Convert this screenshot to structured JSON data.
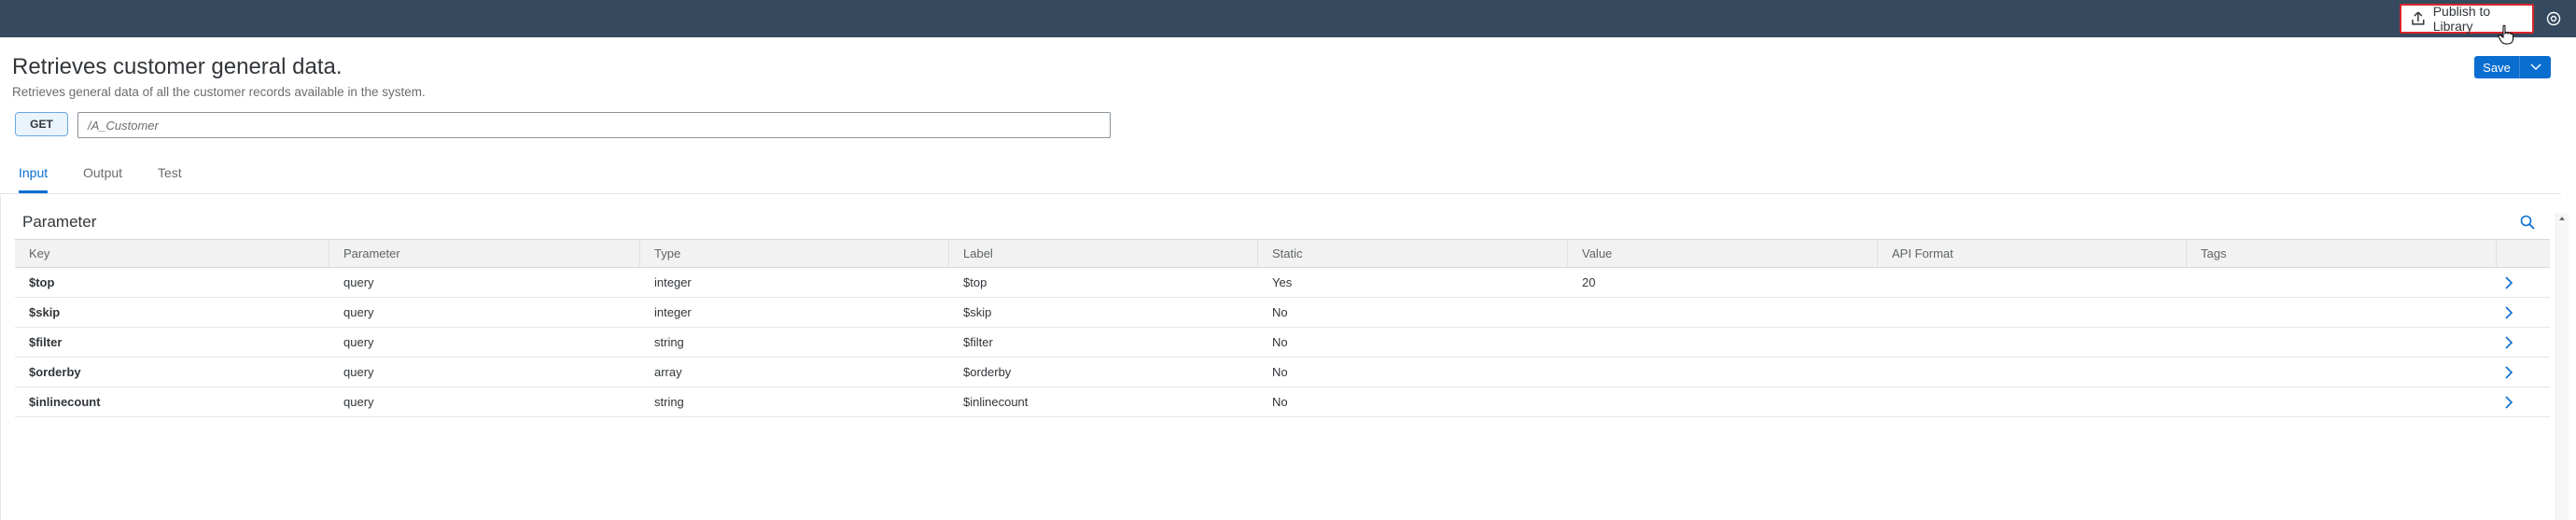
{
  "shell": {
    "publish_label": "Publish to Library",
    "icons": [
      "upload-icon",
      "settings-icon",
      "hand-cursor-icon"
    ]
  },
  "header": {
    "title": "Retrieves customer general data.",
    "subtitle": "Retrieves general data of all the customer records available in the system.",
    "save_label": "Save"
  },
  "request": {
    "method": "GET",
    "path": "/A_Customer"
  },
  "tabs": [
    {
      "label": "Input",
      "active": true
    },
    {
      "label": "Output",
      "active": false
    },
    {
      "label": "Test",
      "active": false
    }
  ],
  "parameters": {
    "title": "Parameter",
    "columns": [
      "Key",
      "Parameter",
      "Type",
      "Label",
      "Static",
      "Value",
      "API Format",
      "Tags"
    ],
    "rows": [
      {
        "key": "$top",
        "parameter": "query",
        "type": "integer",
        "label": "$top",
        "static": "Yes",
        "value": "20",
        "api_format": "",
        "tags": ""
      },
      {
        "key": "$skip",
        "parameter": "query",
        "type": "integer",
        "label": "$skip",
        "static": "No",
        "value": "",
        "api_format": "",
        "tags": ""
      },
      {
        "key": "$filter",
        "parameter": "query",
        "type": "string",
        "label": "$filter",
        "static": "No",
        "value": "",
        "api_format": "",
        "tags": ""
      },
      {
        "key": "$orderby",
        "parameter": "query",
        "type": "array",
        "label": "$orderby",
        "static": "No",
        "value": "",
        "api_format": "",
        "tags": ""
      },
      {
        "key": "$inlinecount",
        "parameter": "query",
        "type": "string",
        "label": "$inlinecount",
        "static": "No",
        "value": "",
        "api_format": "",
        "tags": ""
      }
    ]
  },
  "colors": {
    "shell": "#354a5f",
    "accent": "#0a6ed1",
    "highlight": "#d9262c"
  }
}
